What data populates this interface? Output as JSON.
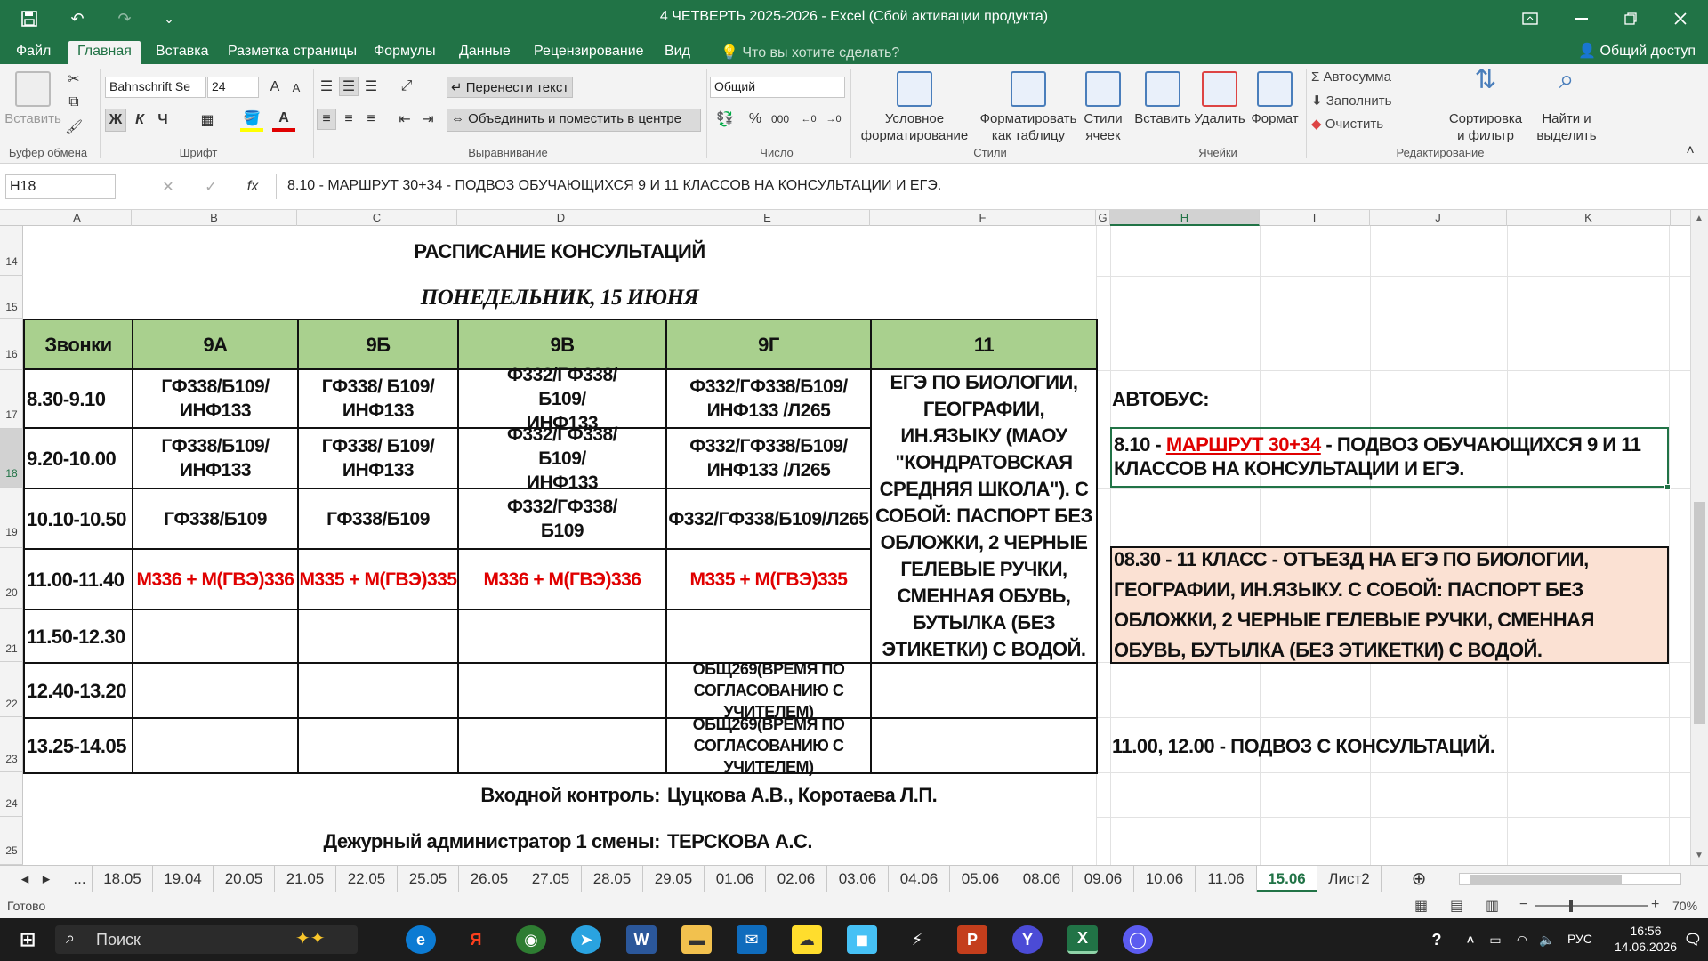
{
  "window": {
    "title": "4 ЧЕТВЕРТЬ 2025-2026 - Excel (Сбой активации продукта)"
  },
  "qat": {
    "undo": "↶",
    "redo": "↷",
    "more": "⌄"
  },
  "ribbon_tabs": [
    "Файл",
    "Главная",
    "Вставка",
    "Разметка страницы",
    "Формулы",
    "Данные",
    "Рецензирование",
    "Вид"
  ],
  "tell_me": "Что вы хотите сделать?",
  "share": "Общий доступ",
  "ribbon": {
    "paste": "Вставить",
    "clipboard_label": "Буфер обмена",
    "font_name": "Bahnschrift Se",
    "font_size": "24",
    "font_label": "Шрифт",
    "bold": "Ж",
    "italic": "К",
    "underline": "Ч",
    "wrap_text": "Перенести текст",
    "merge_center": "Объединить и поместить в центре",
    "alignment_label": "Выравнивание",
    "number_format": "Общий",
    "number_label": "Число",
    "cond_format_1": "Условное",
    "cond_format_2": "форматирование",
    "format_table_1": "Форматировать",
    "format_table_2": "как таблицу",
    "cell_styles_1": "Стили",
    "cell_styles_2": "ячеек",
    "styles_label": "Стили",
    "insert": "Вставить",
    "delete": "Удалить",
    "format": "Формат",
    "cells_label": "Ячейки",
    "autosum": "Автосумма",
    "fill": "Заполнить",
    "clear": "Очистить",
    "sort_1": "Сортировка",
    "sort_2": "и фильтр",
    "find_1": "Найти и",
    "find_2": "выделить",
    "editing_label": "Редактирование"
  },
  "formula_bar": {
    "name_box": "H18",
    "fx": "fx",
    "formula": "8.10 - МАРШРУТ 30+34 - ПОДВОЗ ОБУЧАЮЩИХСЯ 9 И 11 КЛАССОВ НА КОНСУЛЬТАЦИИ И ЕГЭ."
  },
  "columns": [
    "A",
    "B",
    "C",
    "D",
    "E",
    "F",
    "G",
    "H",
    "I",
    "J",
    "K"
  ],
  "rows": [
    "14",
    "15",
    "16",
    "17",
    "18",
    "19",
    "20",
    "21",
    "22",
    "23",
    "24",
    "25"
  ],
  "schedule": {
    "title": "РАСПИСАНИЕ КОНСУЛЬТАЦИЙ",
    "date": "ПОНЕДЕЛЬНИК, 15 ИЮНЯ",
    "headers": [
      "Звонки",
      "9А",
      "9Б",
      "9В",
      "9Г",
      "11"
    ],
    "times": [
      "8.30-9.10",
      "9.20-10.00",
      "10.10-10.50",
      "11.00-11.40",
      "11.50-12.30",
      "12.40-13.20",
      "13.25-14.05"
    ],
    "r17": [
      "ГФ338/Б109/ИНФ133",
      "ГФ338/ Б109/ИНФ133",
      "Ф332/ГФ338/ Б109/ИНФ133",
      "Ф332/ГФ338/Б109/ИНФ133 /Л265"
    ],
    "r18": [
      "ГФ338/Б109/ИНФ133",
      "ГФ338/ Б109/ИНФ133",
      "Ф332/ГФ338/ Б109/ИНФ133",
      "Ф332/ГФ338/Б109/ИНФ133 /Л265"
    ],
    "r19": [
      "ГФ338/Б109",
      "ГФ338/Б109",
      "Ф332/ГФ338/ Б109",
      "Ф332/ГФ338/Б109/Л265"
    ],
    "r20": [
      "М336 + М(ГВЭ)336",
      "М335 + М(ГВЭ)335",
      "М336 + М(ГВЭ)336",
      "М335 + М(ГВЭ)335"
    ],
    "r22_e": "ОБЩ269(ВРЕМЯ ПО СОГЛАСОВАНИЮ С УЧИТЕЛЕМ)",
    "r23_e": "ОБЩ269(ВРЕМЯ ПО СОГЛАСОВАНИЮ С УЧИТЕЛЕМ)",
    "col11": "ЕГЭ ПО БИОЛОГИИ, ГЕОГРАФИИ, ИН.ЯЗЫКУ (МАОУ \"КОНДРАТОВСКАЯ СРЕДНЯЯ ШКОЛА\"). С СОБОЙ: ПАСПОРТ БЕЗ ОБЛОЖКИ, 2 ЧЕРНЫЕ ГЕЛЕВЫЕ РУЧКИ, СМЕННАЯ ОБУВЬ, БУТЫЛКА (БЕЗ ЭТИКЕТКИ) С ВОДОЙ.",
    "control_label": "Входной контроль:",
    "control_value": "Цуцкова А.В., Коротаева Л.П.",
    "admin_label": "Дежурный администратор 1 смены:",
    "admin_value": "ТЕРСКОВА А.С."
  },
  "notes": {
    "bus_title": "АВТОБУС:",
    "h18_prefix": "8.10 - ",
    "h18_route": "МАРШРУТ 30+34",
    "h18_rest": " - ПОДВОЗ ОБУЧАЮЩИХСЯ 9 И 11 КЛАССОВ НА КОНСУЛЬТАЦИИ И ЕГЭ.",
    "h20": "08.30 - 11 КЛАСС - ОТЪЕЗД НА ЕГЭ ПО БИОЛОГИИ, ГЕОГРАФИИ, ИН.ЯЗЫКУ. С СОБОЙ: ПАСПОРТ БЕЗ ОБЛОЖКИ, 2 ЧЕРНЫЕ ГЕЛЕВЫЕ РУЧКИ, СМЕННАЯ ОБУВЬ, БУТЫЛКА (БЕЗ ЭТИКЕТКИ) С ВОДОЙ.",
    "h23": "11.00, 12.00 - ПОДВОЗ С КОНСУЛЬТАЦИЙ."
  },
  "sheet_tabs": [
    "18.05",
    "19.04",
    "20.05",
    "21.05",
    "22.05",
    "25.05",
    "26.05",
    "27.05",
    "28.05",
    "29.05",
    "01.06",
    "02.06",
    "03.06",
    "04.06",
    "05.06",
    "08.06",
    "09.06",
    "10.06",
    "11.06",
    "15.06",
    "Лист2"
  ],
  "active_sheet": "15.06",
  "sheet_nav_more": "...",
  "status": {
    "ready": "Готово",
    "zoom": "70%"
  },
  "taskbar": {
    "search": "Поиск",
    "lang": "РУС",
    "time": "16:56",
    "date": "14.06.2026"
  },
  "colors": {
    "excel_green": "#217346",
    "header_fill": "#a9d08e",
    "note_fill": "#fbe1d3",
    "red_text": "#e00000"
  }
}
